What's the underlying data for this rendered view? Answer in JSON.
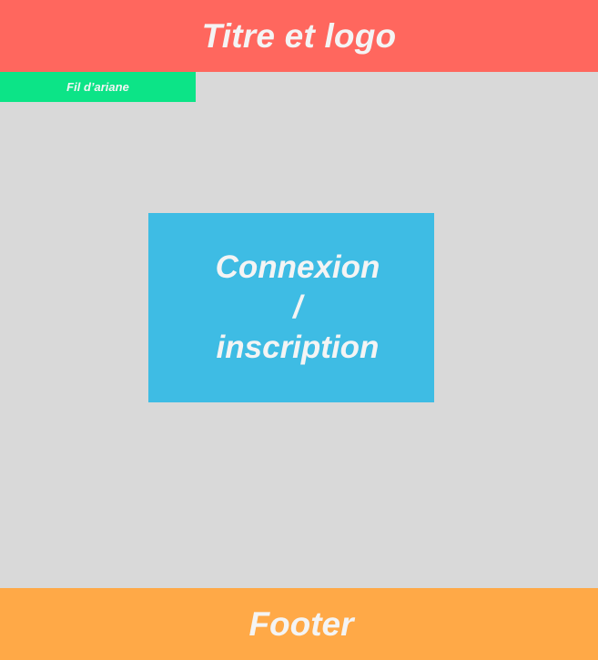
{
  "header": {
    "title": "Titre et logo",
    "color": "#ff675e"
  },
  "breadcrumb": {
    "label": "Fil d’ariane",
    "color": "#0ce487"
  },
  "login_box": {
    "label": "Connexion\n/\ninscription",
    "color": "#3ebce4"
  },
  "footer": {
    "label": "Footer",
    "color": "#ffa947"
  },
  "background_color": "#d9d9d9",
  "text_color": "#f4f4f4"
}
